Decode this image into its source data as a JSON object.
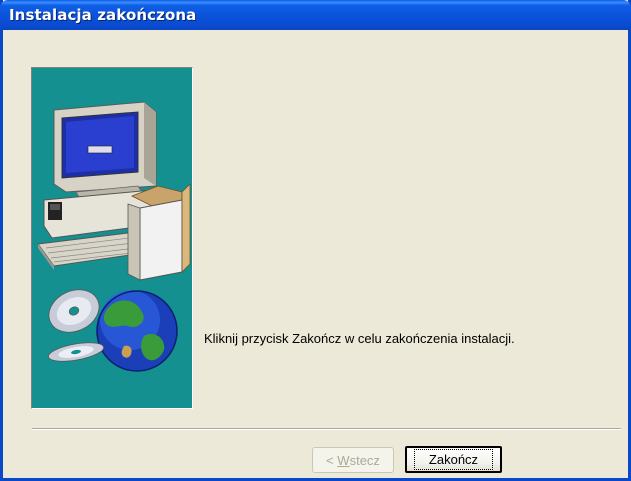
{
  "window": {
    "title": "Instalacja zakończona"
  },
  "banner": {
    "image": "computer-with-cd-and-globe-illustration"
  },
  "content": {
    "message": "Kliknij przycisk Zakończ w celu zakończenia instalacji."
  },
  "buttons": {
    "back": {
      "prefix": "< ",
      "mnemonic": "W",
      "rest": "stecz",
      "enabled": false
    },
    "finish": {
      "label": "Zakończ",
      "enabled": true
    }
  },
  "colors": {
    "banner_bg": "#13908f",
    "titlebar": "#0b52da",
    "dialog_bg": "#ece9d8"
  }
}
